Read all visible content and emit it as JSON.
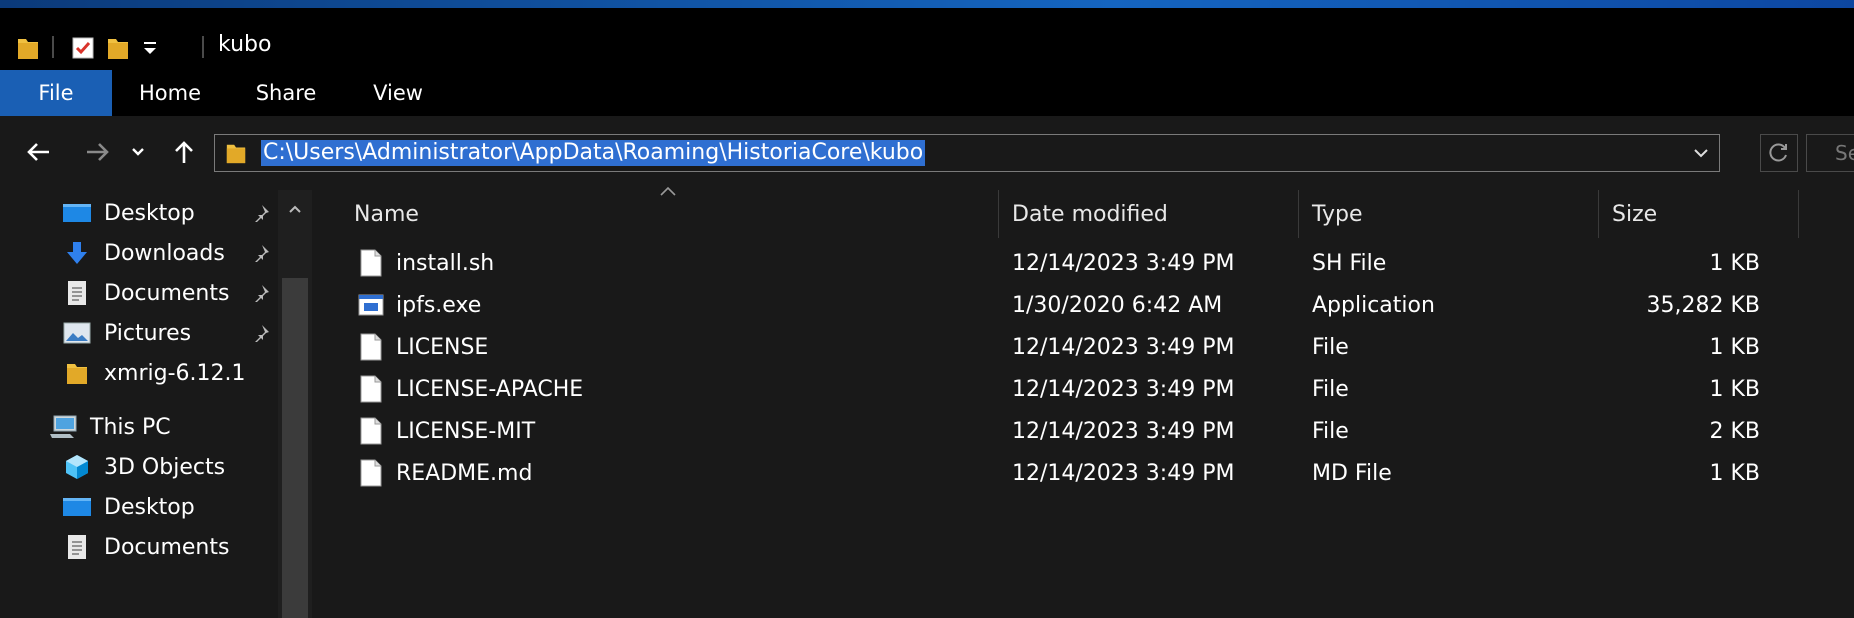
{
  "window": {
    "title": "kubo"
  },
  "ribbon": {
    "tabs": [
      "File",
      "Home",
      "Share",
      "View"
    ]
  },
  "address": {
    "path": "C:\\Users\\Administrator\\AppData\\Roaming\\HistoriaCore\\kubo",
    "search_placeholder": "Se"
  },
  "sidebar": {
    "quick_access": [
      {
        "label": "Desktop",
        "icon": "desktop-icon",
        "pinned": true
      },
      {
        "label": "Downloads",
        "icon": "downloads-icon",
        "pinned": true
      },
      {
        "label": "Documents",
        "icon": "documents-icon",
        "pinned": true
      },
      {
        "label": "Pictures",
        "icon": "pictures-icon",
        "pinned": true
      },
      {
        "label": "xmrig-6.12.1",
        "icon": "folder-icon",
        "pinned": false
      }
    ],
    "this_pc": {
      "label": "This PC",
      "icon": "computer-icon"
    },
    "pc_items": [
      {
        "label": "3D Objects",
        "icon": "3d-objects-icon"
      },
      {
        "label": "Desktop",
        "icon": "desktop-icon"
      },
      {
        "label": "Documents",
        "icon": "documents-icon"
      }
    ]
  },
  "files": {
    "columns": [
      "Name",
      "Date modified",
      "Type",
      "Size"
    ],
    "rows": [
      {
        "name": "install.sh",
        "date": "12/14/2023 3:49 PM",
        "type": "SH File",
        "size": "1 KB",
        "icon": "file-icon"
      },
      {
        "name": "ipfs.exe",
        "date": "1/30/2020 6:42 AM",
        "type": "Application",
        "size": "35,282 KB",
        "icon": "application-icon"
      },
      {
        "name": "LICENSE",
        "date": "12/14/2023 3:49 PM",
        "type": "File",
        "size": "1 KB",
        "icon": "file-icon"
      },
      {
        "name": "LICENSE-APACHE",
        "date": "12/14/2023 3:49 PM",
        "type": "File",
        "size": "1 KB",
        "icon": "file-icon"
      },
      {
        "name": "LICENSE-MIT",
        "date": "12/14/2023 3:49 PM",
        "type": "File",
        "size": "2 KB",
        "icon": "file-icon"
      },
      {
        "name": "README.md",
        "date": "12/14/2023 3:49 PM",
        "type": "MD File",
        "size": "1 KB",
        "icon": "file-icon"
      }
    ]
  },
  "colors": {
    "background": "#191919",
    "accent": "#1a5fb4",
    "selection": "#2f6fd1",
    "folder": "#f0c040"
  }
}
